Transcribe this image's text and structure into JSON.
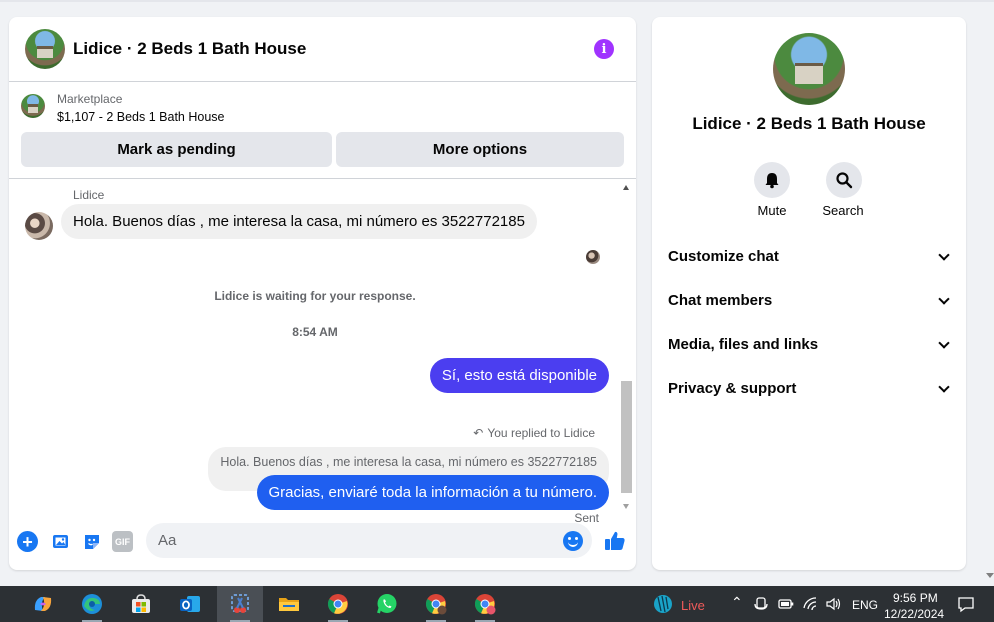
{
  "chat": {
    "title": "Lidice · 2 Beds 1 Bath House",
    "listing": {
      "category": "Marketplace",
      "price_title": "$1,107 - 2 Beds 1 Bath House",
      "mark_pending_label": "Mark as pending",
      "more_options_label": "More options"
    },
    "messages": {
      "sender_name": "Lidice",
      "incoming_text": "Hola. Buenos días , me interesa la casa, mi número es 3522772185",
      "waiting_notice": "Lidice is waiting for your response.",
      "timestamp": "8:54 AM",
      "outgoing_1": "Sí, esto está disponible",
      "replied_label": "You replied to Lidice",
      "quoted_text": "Hola. Buenos días , me interesa la casa, mi número es 3522772185",
      "outgoing_2": "Gracias, enviaré toda la información a tu número.",
      "status": "Sent"
    },
    "composer": {
      "placeholder": "Aa",
      "gif_label": "GIF"
    }
  },
  "info_panel": {
    "title": "Lidice · 2 Beds 1 Bath House",
    "actions": [
      {
        "label": "Mute",
        "icon": "bell-icon"
      },
      {
        "label": "Search",
        "icon": "search-icon"
      }
    ],
    "sections": [
      {
        "label": "Customize chat"
      },
      {
        "label": "Chat members"
      },
      {
        "label": "Media, files and links"
      },
      {
        "label": "Privacy & support"
      }
    ]
  },
  "taskbar": {
    "apps": [
      "copilot-icon",
      "edge-icon",
      "store-icon",
      "outlook-icon",
      "snipping-tool-icon",
      "file-explorer-icon",
      "chrome-icon",
      "whatsapp-icon",
      "chrome-profile-icon",
      "chrome-profile-2-icon"
    ],
    "weather_label": "Live",
    "language": "ENG",
    "time": "9:56 PM",
    "date": "12/22/2024"
  },
  "colors": {
    "accent_blue": "#1877f2",
    "outgoing_bubble_1": "#4b3ef0",
    "outgoing_bubble_2": "#1f5ff0",
    "info_icon": "#a033ff",
    "taskbar_bg": "#2c3034"
  }
}
